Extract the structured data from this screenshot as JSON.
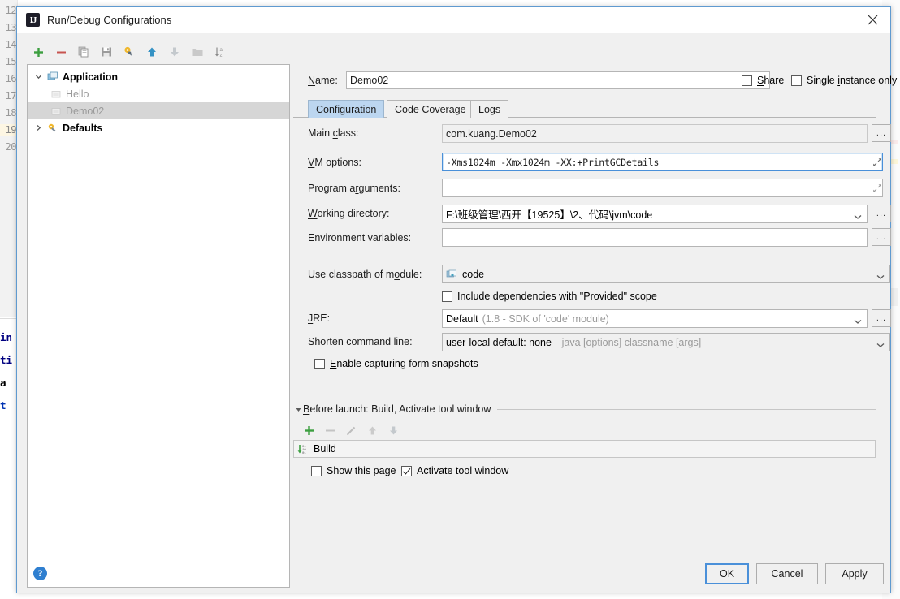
{
  "window": {
    "title": "Run/Debug Configurations",
    "app_icon": "intellij-idea-icon",
    "close_label": "✕"
  },
  "tree_toolbar": {
    "buttons": [
      {
        "name": "add-configuration-button",
        "icon": "plus-icon",
        "tooltip": "Add New Configuration"
      },
      {
        "name": "remove-configuration-button",
        "icon": "minus-icon",
        "tooltip": "Remove Configuration"
      },
      {
        "name": "copy-configuration-button",
        "icon": "copy-icon",
        "tooltip": "Copy Configuration"
      },
      {
        "name": "save-configuration-button",
        "icon": "save-icon",
        "tooltip": "Save Configuration"
      },
      {
        "name": "edit-templates-button",
        "icon": "gear-wrench-icon",
        "tooltip": "Edit Templates"
      },
      {
        "name": "move-up-button",
        "icon": "arrow-up-icon",
        "tooltip": "Move Up"
      },
      {
        "name": "move-down-button",
        "icon": "arrow-down-icon",
        "tooltip": "Move Down"
      },
      {
        "name": "create-folder-button",
        "icon": "folder-icon",
        "tooltip": "Create New Folder"
      },
      {
        "name": "sort-configurations-button",
        "icon": "sort-az-icon",
        "tooltip": "Sort Configurations"
      }
    ]
  },
  "tree": {
    "nodes": [
      {
        "label": "Application",
        "icon": "application-icon",
        "expanded": true,
        "style": "bold",
        "selected": false
      },
      {
        "label": "Hello",
        "icon": "run-config-icon",
        "style": "dim",
        "selected": false,
        "child": true
      },
      {
        "label": "Demo02",
        "icon": "run-config-icon",
        "style": "dim",
        "selected": true,
        "child": true
      },
      {
        "label": "Defaults",
        "icon": "defaults-icon",
        "expanded": false,
        "style": "bold",
        "selected": false
      }
    ]
  },
  "name_row": {
    "label": "Name:",
    "mnemonic": "N",
    "value": "Demo02",
    "share": {
      "label": "Share",
      "mnemonic": "S",
      "checked": false
    },
    "single_instance": {
      "label": "Single instance only",
      "mnemonic": "i",
      "checked": false
    }
  },
  "tabs": [
    {
      "label": "Configuration",
      "active": true
    },
    {
      "label": "Code Coverage",
      "active": false
    },
    {
      "label": "Logs",
      "active": false
    }
  ],
  "fields": {
    "main_class": {
      "label": "Main class:",
      "mnemonic": "c",
      "value": "com.kuang.Demo02",
      "browse_label": "..."
    },
    "vm_options": {
      "label": "VM options:",
      "mnemonic": "V",
      "value": "-Xms1024m -Xmx1024m -XX:+PrintGCDetails",
      "focused": true,
      "expand_icon": "expand-arrows-icon"
    },
    "program_arguments": {
      "label": "Program arguments:",
      "mnemonic": "r",
      "value": "",
      "expand_icon": "expand-arrows-icon"
    },
    "working_directory": {
      "label": "Working directory:",
      "mnemonic": "W",
      "value": "F:\\班级管理\\西开【19525】\\2、代码\\jvm\\code",
      "browse_label": "..."
    },
    "environment_variables": {
      "label": "Environment variables:",
      "mnemonic": "E",
      "value": "",
      "browse_label": "..."
    },
    "use_classpath_of_module": {
      "label": "Use classpath of module:",
      "mnemonic": "o",
      "value": "code",
      "icon": "module-icon"
    },
    "include_provided": {
      "label": "Include dependencies with \"Provided\" scope",
      "checked": false
    },
    "jre": {
      "label": "JRE:",
      "mnemonic": "J",
      "value": "Default",
      "value_suffix": "(1.8 - SDK of 'code' module)",
      "browse_label": "..."
    },
    "shorten_command_line": {
      "label": "Shorten command line:",
      "mnemonic": "l",
      "value": "user-local default: none",
      "value_suffix": "- java [options] classname [args]"
    },
    "enable_capturing": {
      "label": "Enable capturing form snapshots",
      "mnemonic": "E",
      "checked": false
    }
  },
  "before_launch": {
    "title": "Before launch: Build, Activate tool window",
    "mnemonic": "B",
    "toolbar": [
      {
        "name": "bl-add-button",
        "icon": "plus-icon",
        "enabled": true
      },
      {
        "name": "bl-remove-button",
        "icon": "minus-icon",
        "enabled": false
      },
      {
        "name": "bl-edit-button",
        "icon": "pencil-icon",
        "enabled": false
      },
      {
        "name": "bl-move-up-button",
        "icon": "arrow-up-icon",
        "enabled": false
      },
      {
        "name": "bl-move-down-button",
        "icon": "arrow-down-icon",
        "enabled": false
      }
    ],
    "items": [
      {
        "label": "Build",
        "icon": "compile-icon"
      }
    ],
    "show_this_page": {
      "label": "Show this page",
      "checked": false
    },
    "activate_tool_window": {
      "label": "Activate tool window",
      "checked": true
    }
  },
  "footer": {
    "help_label": "?",
    "ok_label": "OK",
    "cancel_label": "Cancel",
    "apply_label": "Apply"
  },
  "background_editor": {
    "line_numbers": [
      "12",
      "13",
      "14",
      "15",
      "16",
      "17",
      "18",
      "19",
      "20"
    ],
    "highlighted_line": "19",
    "code_fragments": [
      "in",
      "ti",
      "a",
      "t"
    ]
  },
  "colors": {
    "accent": "#4a90d9",
    "tab_active": "#bcd6f0",
    "selection": "#d6d6d6",
    "dialog_bg": "#f0f0f0",
    "help_blue": "#2f7fd0",
    "green": "#3c9f40",
    "red": "#c75450"
  }
}
